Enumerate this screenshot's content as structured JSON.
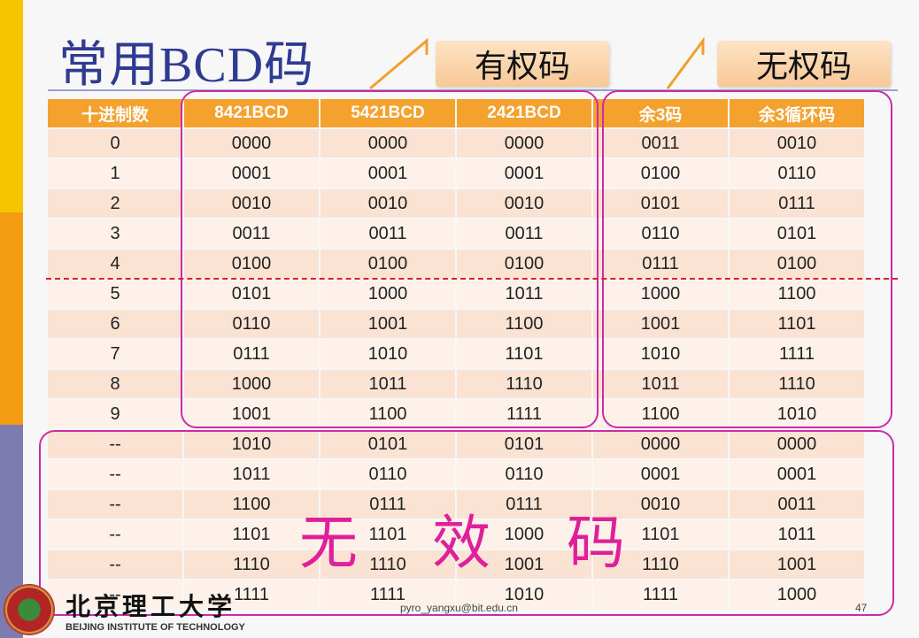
{
  "slide": {
    "title": "常用BCD码",
    "callout_weighted": "有权码",
    "callout_unweighted": "无权码",
    "invalid_label": [
      "无",
      "效",
      "码"
    ],
    "email": "pyro_yangxu@bit.edu.cn",
    "page_number": "47",
    "university_cn": "北京理工大学",
    "university_en": "BEIJING INSTITUTE OF TECHNOLOGY"
  },
  "colors": {
    "accent_box": "#cc2aa7",
    "header_fill": "#f4a12e",
    "divider": "#e02020",
    "title": "#2f3a91"
  },
  "table": {
    "headers": [
      "十进制数",
      "8421BCD",
      "5421BCD",
      "2421BCD",
      "余3码",
      "余3循环码"
    ],
    "rows": [
      [
        "0",
        "0000",
        "0000",
        "0000",
        "0011",
        "0010"
      ],
      [
        "1",
        "0001",
        "0001",
        "0001",
        "0100",
        "0110"
      ],
      [
        "2",
        "0010",
        "0010",
        "0010",
        "0101",
        "0111"
      ],
      [
        "3",
        "0011",
        "0011",
        "0011",
        "0110",
        "0101"
      ],
      [
        "4",
        "0100",
        "0100",
        "0100",
        "0111",
        "0100"
      ],
      [
        "5",
        "0101",
        "1000",
        "1011",
        "1000",
        "1100"
      ],
      [
        "6",
        "0110",
        "1001",
        "1100",
        "1001",
        "1101"
      ],
      [
        "7",
        "0111",
        "1010",
        "1101",
        "1010",
        "1111"
      ],
      [
        "8",
        "1000",
        "1011",
        "1110",
        "1011",
        "1110"
      ],
      [
        "9",
        "1001",
        "1100",
        "1111",
        "1100",
        "1010"
      ],
      [
        "--",
        "1010",
        "0101",
        "0101",
        "0000",
        "0000"
      ],
      [
        "--",
        "1011",
        "0110",
        "0110",
        "0001",
        "0001"
      ],
      [
        "--",
        "1100",
        "0111",
        "0111",
        "0010",
        "0011"
      ],
      [
        "--",
        "1101",
        "1101",
        "1000",
        "1101",
        "1011"
      ],
      [
        "--",
        "1110",
        "1110",
        "1001",
        "1110",
        "1001"
      ],
      [
        "--",
        "1111",
        "1111",
        "1010",
        "1111",
        "1000"
      ]
    ]
  }
}
